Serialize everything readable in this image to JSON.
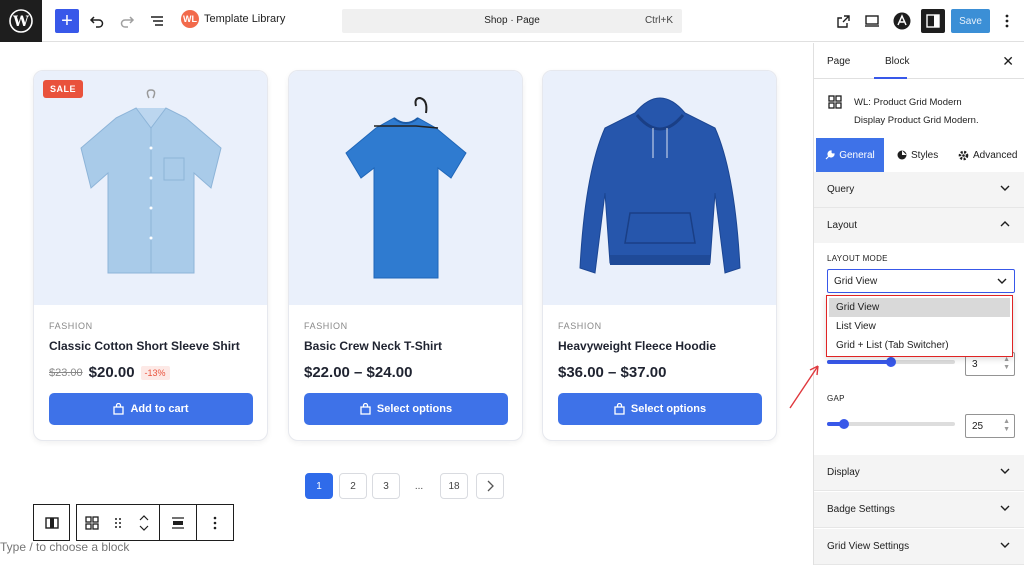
{
  "topbar": {
    "template_library": "Template Library",
    "template_logo_text": "WL",
    "command_title": "Shop · Page",
    "command_shortcut": "Ctrl+K",
    "save_label": "Save"
  },
  "products": [
    {
      "badge": "SALE",
      "category": "FASHION",
      "name": "Classic Cotton Short Sleeve Shirt",
      "old_price": "$23.00",
      "price": "$20.00",
      "discount": "-13%",
      "button": "Add to cart",
      "image": "shirt"
    },
    {
      "badge": "",
      "category": "FASHION",
      "name": "Basic Crew Neck T-Shirt",
      "old_price": "",
      "price": "$22.00 – $24.00",
      "discount": "",
      "button": "Select options",
      "image": "tshirt"
    },
    {
      "badge": "",
      "category": "FASHION",
      "name": "Heavyweight Fleece Hoodie",
      "old_price": "",
      "price": "$36.00 – $37.00",
      "discount": "",
      "button": "Select options",
      "image": "hoodie"
    }
  ],
  "pagination": {
    "pages": [
      "1",
      "2",
      "3",
      "...",
      "18"
    ],
    "current": "1"
  },
  "editor": {
    "type_hint": "Type / to choose a block"
  },
  "panel": {
    "tab_page": "Page",
    "tab_block": "Block",
    "block_title": "WL: Product Grid Modern",
    "block_desc": "Display Product Grid Modern.",
    "subtab_general": "General",
    "subtab_styles": "Styles",
    "subtab_advanced": "Advanced",
    "section_query": "Query",
    "section_layout": "Layout",
    "layout_mode_label": "LAYOUT MODE",
    "layout_mode_value": "Grid View",
    "columns_value": "3",
    "gap_label": "GAP",
    "gap_value": "25",
    "gap_fraction": 0.13,
    "columns_fraction": 0.5,
    "section_display": "Display",
    "section_badge": "Badge Settings",
    "section_gridview": "Grid View Settings"
  },
  "dropdown": {
    "options": [
      "Grid View",
      "List View",
      "Grid + List (Tab Switcher)"
    ],
    "selected": "Grid View"
  },
  "colors": {
    "accent": "#3858e9",
    "button": "#3e72e8",
    "sale": "#e9523c",
    "highlight": "#e02424"
  }
}
